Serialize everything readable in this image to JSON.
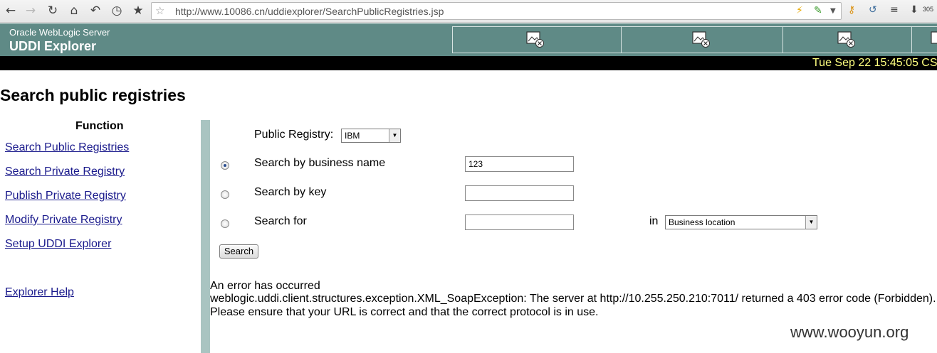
{
  "browser": {
    "url": "http://www.10086.cn/uddiexplorer/SearchPublicRegistries.jsp",
    "download_count": "305",
    "icons": [
      "back-icon",
      "forward-icon",
      "reload-icon",
      "home-icon",
      "undo-icon",
      "history-icon",
      "bookmark-star-icon",
      "url-star-icon",
      "lightning-icon",
      "plugin-icon",
      "dropdown-icon",
      "key-icon",
      "translate-icon",
      "menu-icon",
      "download-icon"
    ]
  },
  "header": {
    "vendor": "Oracle WebLogic Server",
    "title": "UDDI Explorer",
    "date": "Tue Sep 22 15:45:05 CS"
  },
  "page": {
    "title": "Search public registries"
  },
  "sidebar": {
    "heading": "Function",
    "links": [
      "Search Public Registries",
      "Search Private Registry",
      "Publish Private Registry",
      "Modify Private Registry",
      "Setup UDDI Explorer",
      "Explorer Help"
    ]
  },
  "form": {
    "registry_label": "Public Registry:",
    "registry_value": "IBM",
    "by_name_label": "Search by business name",
    "by_name_value": "123",
    "by_key_label": "Search by key",
    "by_key_value": "",
    "search_for_label": "Search for",
    "search_for_value": "",
    "in_label": "in",
    "location_value": "Business location",
    "selected_option": "Search by business name",
    "search_button": "Search"
  },
  "error": {
    "line1": "An error has occurred",
    "line2": "weblogic.uddi.client.structures.exception.XML_SoapException: The server at http://10.255.250.210:7011/ returned a 403 error code (Forbidden).",
    "line3": "Please ensure that your URL is correct and that the correct protocol is in use."
  },
  "watermark": "www.wooyun.org",
  "colors": {
    "header_bg": "#5f8a86",
    "date_text": "#ffff80",
    "link": "#1a1a8c",
    "divider": "#a9c4c1"
  }
}
